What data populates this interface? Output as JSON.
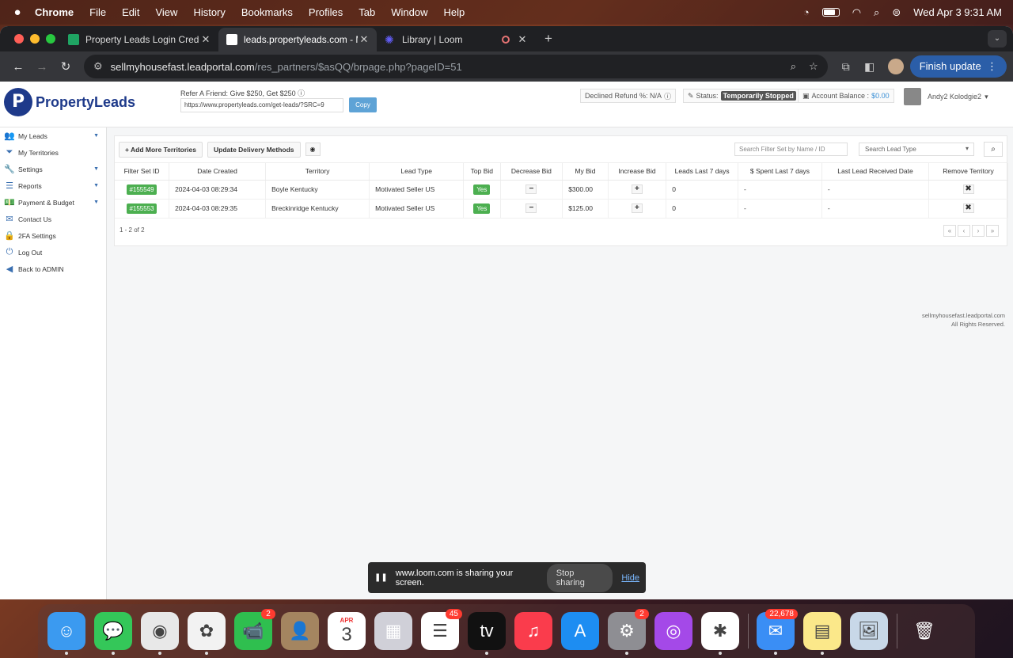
{
  "menubar": {
    "apple": "",
    "app": "Chrome",
    "items": [
      "File",
      "Edit",
      "View",
      "History",
      "Bookmarks",
      "Profiles",
      "Tab",
      "Window",
      "Help"
    ],
    "datetime": "Wed Apr 3  9:31 AM"
  },
  "tabs": [
    {
      "title": "Property Leads Login Creden"
    },
    {
      "title": "leads.propertyleads.com - M"
    },
    {
      "title": "Library | Loom"
    }
  ],
  "toolbar": {
    "url_host": "sellmyhousefast.leadportal.com",
    "url_path": "/res_partners/$asQQ/brpage.php?pageID=51",
    "finish_update": "Finish update"
  },
  "header": {
    "logo_text": "PropertyLeads",
    "logo_mark": "P",
    "refer_text": "Refer A Friend: Give $250, Get $250",
    "refer_url": "https://www.propertyleads.com/get-leads/?SRC=9",
    "copy_label": "Copy",
    "declined_refund": "Declined Refund %: N/A",
    "status_label": "Status:",
    "status_value": "Temporarily Stopped",
    "balance_label": "Account Balance :",
    "balance_value": "$0.00",
    "user_name": "Andy2 Kolodgie2"
  },
  "sidebar": {
    "items": [
      {
        "label": "My Leads",
        "icon": "users-icon",
        "glyph": "👥",
        "has_chevron": true
      },
      {
        "label": "My Territories",
        "icon": "filter-icon",
        "glyph": "⏷",
        "has_chevron": false
      },
      {
        "label": "Settings",
        "icon": "wrench-icon",
        "glyph": "🔧",
        "has_chevron": true
      },
      {
        "label": "Reports",
        "icon": "list-icon",
        "glyph": "☰",
        "has_chevron": true
      },
      {
        "label": "Payment & Budget",
        "icon": "money-icon",
        "glyph": "💵",
        "has_chevron": true
      },
      {
        "label": "Contact Us",
        "icon": "envelope-icon",
        "glyph": "✉",
        "has_chevron": false
      },
      {
        "label": "2FA Settings",
        "icon": "lock-icon",
        "glyph": "🔒",
        "has_chevron": false
      },
      {
        "label": "Log Out",
        "icon": "power-icon",
        "glyph": "⏻",
        "has_chevron": false
      },
      {
        "label": "Back to ADMIN",
        "icon": "back-arrow-icon",
        "glyph": "◀",
        "has_chevron": false
      }
    ]
  },
  "content": {
    "add_territories": "+ Add More Territories",
    "update_delivery": "Update Delivery Methods",
    "filter_placeholder": "Search Filter Set by Name / ID",
    "lead_type_placeholder": "Search Lead Type",
    "columns": [
      "Filter Set ID",
      "Date Created",
      "Territory",
      "Lead Type",
      "Top Bid",
      "Decrease Bid",
      "My Bid",
      "Increase Bid",
      "Leads Last 7 days",
      "$ Spent Last 7 days",
      "Last Lead Received Date",
      "Remove Territory"
    ],
    "rows": [
      {
        "id": "#155549",
        "date": "2024-04-03 08:29:34",
        "territory": "Boyle Kentucky",
        "lead_type": "Motivated Seller US",
        "top_bid": "Yes",
        "decrease": "−",
        "my_bid": "$300.00",
        "increase": "+",
        "leads7": "0",
        "spent7": "-",
        "last_lead": "-",
        "remove": "✖"
      },
      {
        "id": "#155553",
        "date": "2024-04-03 08:29:35",
        "territory": "Breckinridge Kentucky",
        "lead_type": "Motivated Seller US",
        "top_bid": "Yes",
        "decrease": "−",
        "my_bid": "$125.00",
        "increase": "+",
        "leads7": "0",
        "spent7": "-",
        "last_lead": "-",
        "remove": "✖"
      }
    ],
    "pager_info": "1 - 2 of 2",
    "pager_buttons": [
      "«",
      "‹",
      "›",
      "»"
    ]
  },
  "footer": {
    "line1": "sellmyhousefast.leadportal.com",
    "line2": "All Rights Reserved."
  },
  "loom_bar": {
    "message": "www.loom.com is sharing your screen.",
    "stop_label": "Stop sharing",
    "hide_label": "Hide"
  },
  "dock": {
    "apps": [
      {
        "name": "finder-icon",
        "color": "#3b9af0",
        "glyph": "☺",
        "badge": "",
        "dot": true
      },
      {
        "name": "messages-icon",
        "color": "#34c759",
        "glyph": "💬",
        "badge": "",
        "dot": true
      },
      {
        "name": "chrome-icon",
        "color": "#e8e8e8",
        "glyph": "◉",
        "badge": "",
        "dot": true
      },
      {
        "name": "photos-icon",
        "color": "#f2f2f2",
        "glyph": "✿",
        "badge": "",
        "dot": true
      },
      {
        "name": "facetime-icon",
        "color": "#2fbf4f",
        "glyph": "📹",
        "badge": "2",
        "dot": false
      },
      {
        "name": "contacts-icon",
        "color": "#a48560",
        "glyph": "👤",
        "badge": "",
        "dot": false
      },
      {
        "name": "calendar-icon",
        "color": "#ffffff",
        "glyph": "3",
        "badge": "",
        "dot": false,
        "month": "APR"
      },
      {
        "name": "launchpad-icon",
        "color": "#d0d0d8",
        "glyph": "▦",
        "badge": "",
        "dot": false
      },
      {
        "name": "reminders-icon",
        "color": "#ffffff",
        "glyph": "☰",
        "badge": "45",
        "dot": false
      },
      {
        "name": "apple-tv-icon",
        "color": "#111111",
        "glyph": "tv",
        "badge": "",
        "dot": true
      },
      {
        "name": "music-icon",
        "color": "#fa3c4c",
        "glyph": "♫",
        "badge": "",
        "dot": false
      },
      {
        "name": "app-store-icon",
        "color": "#1d8df2",
        "glyph": "A",
        "badge": "",
        "dot": false
      },
      {
        "name": "system-settings-icon",
        "color": "#8e8e93",
        "glyph": "⚙",
        "badge": "2",
        "dot": true
      },
      {
        "name": "podcasts-icon",
        "color": "#a449e8",
        "glyph": "◎",
        "badge": "",
        "dot": false
      },
      {
        "name": "slack-icon",
        "color": "#ffffff",
        "glyph": "✱",
        "badge": "",
        "dot": true
      },
      {
        "name": "mail-icon",
        "color": "#3a8ef5",
        "glyph": "✉",
        "badge": "22,678",
        "dot": true,
        "after_sep": true
      },
      {
        "name": "notes-icon",
        "color": "#fbe88a",
        "glyph": "▤",
        "badge": "",
        "dot": true
      },
      {
        "name": "preview-icon",
        "color": "#c8d8e8",
        "glyph": "🖼",
        "badge": "",
        "dot": false
      },
      {
        "name": "trash-icon",
        "color": "transparent",
        "glyph": "🗑",
        "badge": "",
        "dot": false,
        "after_sep2": true
      }
    ]
  }
}
